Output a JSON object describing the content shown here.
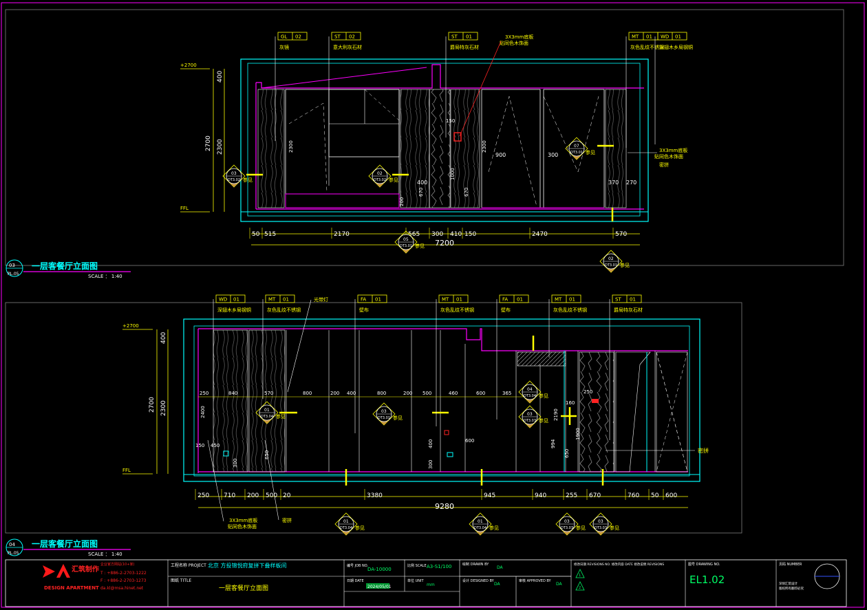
{
  "colors": {
    "background": "#000000",
    "frame": "#ff00ff",
    "wall": "#00ffff",
    "dim": "#ffff00",
    "text": "#ffffff",
    "wood": "#5a5a5a",
    "logo": "#ff1a1a"
  },
  "elev1": {
    "title": "一层客餐厅立面图",
    "scale_label": "SCALE ：  1:40",
    "badge_num": "03",
    "badge_sheet": "PL.05",
    "levels": [
      "+2700",
      "FFL"
    ],
    "height_dims": [
      "400",
      "2700",
      "2300"
    ],
    "tags": [
      {
        "code": "GL",
        "num": "02",
        "desc": "灰镜"
      },
      {
        "code": "ST",
        "num": "02",
        "desc": "意大利灰石材"
      },
      {
        "code": "ST",
        "num": "01",
        "desc": "爵局特灰石材"
      },
      {
        "code": "",
        "num": "",
        "desc": "3X3mm底板"
      },
      {
        "code": "",
        "num": "",
        "desc": "贴同色木饰面"
      },
      {
        "code": "MT",
        "num": "01",
        "desc": "灰色乱纹不锈钢"
      },
      {
        "code": "WD",
        "num": "01",
        "desc": "深翅木乡局钢铜"
      },
      {
        "code": "",
        "num": "",
        "desc": "3X3mm底板"
      },
      {
        "code": "",
        "num": "",
        "desc": "贴同色木饰面"
      },
      {
        "code": "",
        "num": "",
        "desc": "密拼"
      }
    ],
    "inner_dims": [
      "2300",
      "150",
      "2300",
      "900",
      "300",
      "400",
      "1000",
      "670",
      "670",
      "370",
      "270",
      "570",
      "200"
    ],
    "bottom_dims": [
      "50",
      "515",
      "2170",
      "565",
      "300",
      "410",
      "150",
      "2470",
      "570"
    ],
    "total_dim": "7200",
    "callouts": [
      {
        "num": "03",
        "sheet": "DT3.02"
      },
      {
        "num": "02",
        "sheet": "DT3.02"
      },
      {
        "num": "07",
        "sheet": "DT3.01"
      },
      {
        "num": "05",
        "sheet": "DT3.01"
      },
      {
        "num": "02",
        "sheet": "DT3.01"
      }
    ],
    "ref_word": "参见"
  },
  "elev2": {
    "title": "一层客餐厅立面图",
    "scale_label": "SCALE ：  1:40",
    "badge_num": "04",
    "badge_sheet": "PL.05",
    "levels": [
      "+2700",
      "FFL"
    ],
    "height_dims": [
      "400",
      "2700",
      "2300"
    ],
    "tags": [
      {
        "code": "WD",
        "num": "01",
        "desc": "深翅木乡局钢铜"
      },
      {
        "code": "MT",
        "num": "01",
        "desc": "灰色乱纹不锈钢"
      },
      {
        "code": "",
        "num": "",
        "desc": "光带灯"
      },
      {
        "code": "FA",
        "num": "01",
        "desc": "壁布"
      },
      {
        "code": "MT",
        "num": "01",
        "desc": "灰色乱纹不锈钢"
      },
      {
        "code": "FA",
        "num": "01",
        "desc": "壁布"
      },
      {
        "code": "MT",
        "num": "01",
        "desc": "灰色乱纹不锈钢"
      },
      {
        "code": "ST",
        "num": "01",
        "desc": "爵局特灰石材"
      }
    ],
    "inner_dims": [
      "250",
      "840",
      "570",
      "800",
      "200",
      "400",
      "800",
      "200",
      "500",
      "460",
      "600",
      "365",
      "250",
      "160",
      "2190",
      "1900",
      "994",
      "650",
      "600",
      "400",
      "300",
      "2400",
      "150",
      "450",
      "300",
      "650"
    ],
    "bottom_dims": [
      "250",
      "710",
      "200",
      "500",
      "20",
      "3380",
      "945",
      "940",
      "255",
      "670",
      "760",
      "50",
      "600"
    ],
    "total_dim": "9280",
    "side_note": "密拼",
    "bottom_notes": [
      "3X3mm底板",
      "贴同色木饰面",
      "密拼"
    ],
    "callouts": [
      {
        "num": "01",
        "sheet": "DT3.04"
      },
      {
        "num": "03",
        "sheet": "DT3.01"
      },
      {
        "num": "04",
        "sheet": "DT3.04"
      },
      {
        "num": "03",
        "sheet": "DT3.03"
      },
      {
        "num": "01",
        "sheet": "DT3.04"
      },
      {
        "num": "01",
        "sheet": "DT3.04"
      },
      {
        "num": "03",
        "sheet": "DT3.03"
      },
      {
        "num": "03",
        "sheet": "DT3.03"
      }
    ],
    "ref_word": "参见"
  },
  "titleblock": {
    "logo_main": "DA",
    "logo_cn": "汇筑制作",
    "logo_en": "DESIGN APARTMENT",
    "logo_contact1": "企业官方网站(10+家)",
    "logo_contact2": "T : +886-2-2703-1222",
    "logo_contact3": "F : +886-2-2703-1273",
    "logo_email": "da.kl@msa.hinet.net",
    "project_label": "工程名称 PROJECT",
    "project_value": "北京 方投锦悦府复拼下叠样板间",
    "title_label": "图纸 TITLE",
    "title_value": "一层客餐厅立面图",
    "job_label": "编号 JOB NO.",
    "job_value": "DA-10000",
    "date_label": "日期 DATE",
    "date_value": "2024/05/01",
    "scale_label": "比例 SCALE",
    "scale_value": "A3-S1/100",
    "unit_label": "单位 UNIT",
    "unit_value": "mm",
    "drawn_label": "绘制 DRAWN BY",
    "drawn_value": "DA",
    "designed_label": "设计 DESIGNED BY",
    "designed_value": "DA",
    "approved_label": "审核 APPROVED BY",
    "approved_value": "DA",
    "revision_label": "修改日期 REVISIONS NO.  修改内容 DATE  修改说明 REVISIONS",
    "rev1": "1",
    "rev2": "2",
    "drawing_label": "图号 DRAWING NO.",
    "drawing_value": "EL1.02",
    "number_label": "页码 NUMBER",
    "number_note1": "深圳汇筑设计",
    "number_note2": "版权所有翻印必究"
  }
}
